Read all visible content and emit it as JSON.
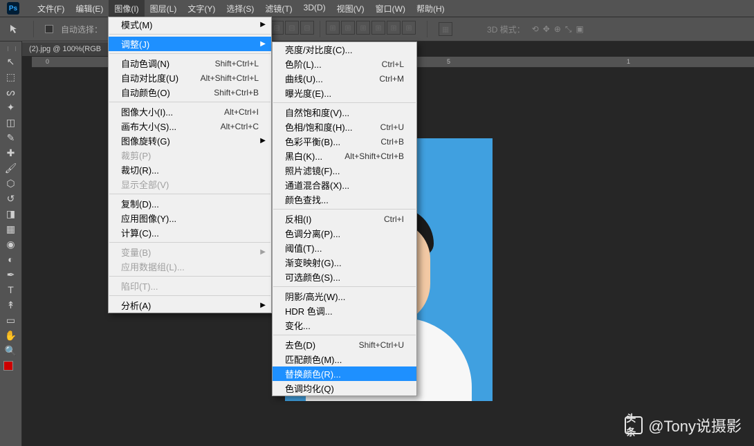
{
  "logo": "Ps",
  "menubar": {
    "items": [
      "文件(F)",
      "编辑(E)",
      "图像(I)",
      "图层(L)",
      "文字(Y)",
      "选择(S)",
      "滤镜(T)",
      "3D(D)",
      "视图(V)",
      "窗口(W)",
      "帮助(H)"
    ],
    "open_index": 2
  },
  "options": {
    "auto_select": "自动选择：",
    "three_d": "3D 模式："
  },
  "doc_tab": "(2).jpg @ 100%(RGB",
  "ruler_marks": [
    "0",
    "5",
    "1"
  ],
  "image_menu": [
    {
      "type": "item",
      "label": "模式(M)",
      "sub": true
    },
    {
      "type": "sep"
    },
    {
      "type": "item",
      "label": "调整(J)",
      "sub": true,
      "selected": true
    },
    {
      "type": "sep"
    },
    {
      "type": "item",
      "label": "自动色调(N)",
      "short": "Shift+Ctrl+L"
    },
    {
      "type": "item",
      "label": "自动对比度(U)",
      "short": "Alt+Shift+Ctrl+L"
    },
    {
      "type": "item",
      "label": "自动颜色(O)",
      "short": "Shift+Ctrl+B"
    },
    {
      "type": "sep"
    },
    {
      "type": "item",
      "label": "图像大小(I)...",
      "short": "Alt+Ctrl+I"
    },
    {
      "type": "item",
      "label": "画布大小(S)...",
      "short": "Alt+Ctrl+C"
    },
    {
      "type": "item",
      "label": "图像旋转(G)",
      "sub": true
    },
    {
      "type": "item",
      "label": "裁剪(P)",
      "disabled": true
    },
    {
      "type": "item",
      "label": "裁切(R)..."
    },
    {
      "type": "item",
      "label": "显示全部(V)",
      "disabled": true
    },
    {
      "type": "sep"
    },
    {
      "type": "item",
      "label": "复制(D)..."
    },
    {
      "type": "item",
      "label": "应用图像(Y)..."
    },
    {
      "type": "item",
      "label": "计算(C)..."
    },
    {
      "type": "sep"
    },
    {
      "type": "item",
      "label": "变量(B)",
      "sub": true,
      "disabled": true
    },
    {
      "type": "item",
      "label": "应用数据组(L)...",
      "disabled": true
    },
    {
      "type": "sep"
    },
    {
      "type": "item",
      "label": "陷印(T)...",
      "disabled": true
    },
    {
      "type": "sep"
    },
    {
      "type": "item",
      "label": "分析(A)",
      "sub": true
    }
  ],
  "adjust_menu": [
    {
      "type": "item",
      "label": "亮度/对比度(C)..."
    },
    {
      "type": "item",
      "label": "色阶(L)...",
      "short": "Ctrl+L"
    },
    {
      "type": "item",
      "label": "曲线(U)...",
      "short": "Ctrl+M"
    },
    {
      "type": "item",
      "label": "曝光度(E)..."
    },
    {
      "type": "sep"
    },
    {
      "type": "item",
      "label": "自然饱和度(V)..."
    },
    {
      "type": "item",
      "label": "色相/饱和度(H)...",
      "short": "Ctrl+U"
    },
    {
      "type": "item",
      "label": "色彩平衡(B)...",
      "short": "Ctrl+B"
    },
    {
      "type": "item",
      "label": "黑白(K)...",
      "short": "Alt+Shift+Ctrl+B"
    },
    {
      "type": "item",
      "label": "照片滤镜(F)..."
    },
    {
      "type": "item",
      "label": "通道混合器(X)..."
    },
    {
      "type": "item",
      "label": "颜色查找..."
    },
    {
      "type": "sep"
    },
    {
      "type": "item",
      "label": "反相(I)",
      "short": "Ctrl+I"
    },
    {
      "type": "item",
      "label": "色调分离(P)..."
    },
    {
      "type": "item",
      "label": "阈值(T)..."
    },
    {
      "type": "item",
      "label": "渐变映射(G)..."
    },
    {
      "type": "item",
      "label": "可选颜色(S)..."
    },
    {
      "type": "sep"
    },
    {
      "type": "item",
      "label": "阴影/高光(W)..."
    },
    {
      "type": "item",
      "label": "HDR 色调..."
    },
    {
      "type": "item",
      "label": "变化..."
    },
    {
      "type": "sep"
    },
    {
      "type": "item",
      "label": "去色(D)",
      "short": "Shift+Ctrl+U"
    },
    {
      "type": "item",
      "label": "匹配颜色(M)..."
    },
    {
      "type": "item",
      "label": "替换颜色(R)...",
      "selected": true
    },
    {
      "type": "item",
      "label": "色调均化(Q)"
    }
  ],
  "tools": [
    "move",
    "marquee",
    "lasso",
    "wand",
    "crop",
    "eyedropper",
    "healing",
    "brush",
    "stamp",
    "history",
    "eraser",
    "gradient",
    "blur",
    "dodge",
    "pen",
    "type",
    "path",
    "rect",
    "hand",
    "zoom"
  ],
  "watermark": {
    "brand": "头条",
    "text": "@Tony说摄影"
  }
}
